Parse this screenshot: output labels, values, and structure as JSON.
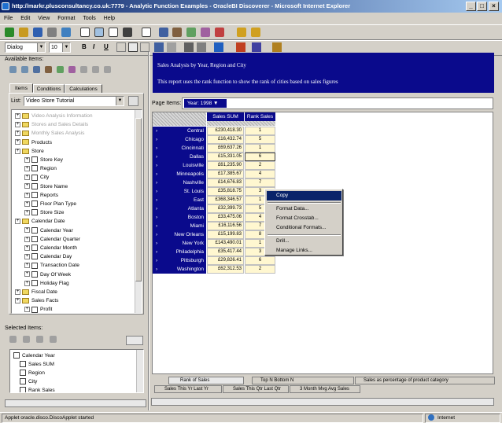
{
  "window": {
    "title": "http://markr.plusconsultancy.co.uk:7779 - Analytic Function Examples - OracleBI Discoverer - Microsoft Internet Explorer"
  },
  "menu": [
    "File",
    "Edit",
    "View",
    "Format",
    "Tools",
    "Help"
  ],
  "format_bar": {
    "font": "Dialog",
    "size": "10",
    "bold": "B",
    "italic": "I",
    "underline": "U"
  },
  "left": {
    "available_label": "Available Items:",
    "tabs": [
      "Items",
      "Conditions",
      "Calculations"
    ],
    "list_label": "List:",
    "list_value": "Video Store Tutorial",
    "tree": [
      {
        "label": "Video Analysis Information",
        "disabled": true,
        "kind": "folder",
        "level": 0
      },
      {
        "label": "Stores and Sales Details",
        "disabled": true,
        "kind": "folder",
        "level": 0
      },
      {
        "label": "Monthly Sales Analysis",
        "disabled": true,
        "kind": "folder",
        "level": 0
      },
      {
        "label": "Products",
        "kind": "folder",
        "level": 0
      },
      {
        "label": "Store",
        "kind": "folder",
        "level": 0
      },
      {
        "label": "Store Key",
        "kind": "item",
        "level": 1
      },
      {
        "label": "Region",
        "kind": "item",
        "level": 1
      },
      {
        "label": "City",
        "kind": "item",
        "level": 1
      },
      {
        "label": "Store Name",
        "kind": "item",
        "level": 1
      },
      {
        "label": "Reports",
        "kind": "item",
        "level": 1
      },
      {
        "label": "Floor Plan Type",
        "kind": "item",
        "level": 1
      },
      {
        "label": "Store Size",
        "kind": "item",
        "level": 1
      },
      {
        "label": "Calendar Date",
        "kind": "folder",
        "level": 0
      },
      {
        "label": "Calendar Year",
        "kind": "item",
        "level": 1
      },
      {
        "label": "Calendar Quarter",
        "kind": "item",
        "level": 1
      },
      {
        "label": "Calendar Month",
        "kind": "item",
        "level": 1
      },
      {
        "label": "Calendar Day",
        "kind": "item",
        "level": 1
      },
      {
        "label": "Transaction Date",
        "kind": "item",
        "level": 1
      },
      {
        "label": "Day Of Week",
        "kind": "item",
        "level": 1
      },
      {
        "label": "Holiday Flag",
        "kind": "item",
        "level": 1
      },
      {
        "label": "Fiscal Date",
        "kind": "folder",
        "level": 0
      },
      {
        "label": "Sales Facts",
        "kind": "folder",
        "level": 0
      },
      {
        "label": "Profit",
        "kind": "item",
        "level": 1
      }
    ],
    "selected_label": "Selected Items:",
    "selected": [
      "Calendar Year",
      "Sales SUM",
      "Region",
      "City",
      "Rank Sales"
    ]
  },
  "report": {
    "title": "Sales Analysis by Year, Region and City",
    "description": "This report uses the rank function to show the rank of cities based on sales figures",
    "page_items_label": "Page Items:",
    "page_item_value": "Year: 1998",
    "col_sum": "Sales SUM",
    "col_rank": "Rank Sales",
    "rows": [
      {
        "city": "Central",
        "sum": "£230,418.30",
        "rank": "1"
      },
      {
        "city": "Chicago",
        "sum": "£16,432.74",
        "rank": "5"
      },
      {
        "city": "Cincinnati",
        "sum": "£69,637.26",
        "rank": "1"
      },
      {
        "city": "Dallas",
        "sum": "£15,331.05",
        "rank": "6"
      },
      {
        "city": "Louisville",
        "sum": "£61,235.90",
        "rank": "2"
      },
      {
        "city": "Minneapolis",
        "sum": "£17,385.67",
        "rank": "4"
      },
      {
        "city": "Nashville",
        "sum": "£14,676.83",
        "rank": "7"
      },
      {
        "city": "St. Louis",
        "sum": "£35,818.75",
        "rank": "3"
      },
      {
        "city": "East",
        "sum": "£368,346.57",
        "rank": "1"
      },
      {
        "city": "Atlanta",
        "sum": "£32,399.73",
        "rank": "5"
      },
      {
        "city": "Boston",
        "sum": "£33,475.06",
        "rank": "4"
      },
      {
        "city": "Miami",
        "sum": "£16,116.56",
        "rank": "7"
      },
      {
        "city": "New Orleans",
        "sum": "£15,199.83",
        "rank": "8"
      },
      {
        "city": "New York",
        "sum": "£143,490.01",
        "rank": "1"
      },
      {
        "city": "Philadelphia",
        "sum": "£35,417.44",
        "rank": "3"
      },
      {
        "city": "Pittsburgh",
        "sum": "£29,826.41",
        "rank": "6"
      },
      {
        "city": "Washington",
        "sum": "£62,312.53",
        "rank": "2"
      }
    ]
  },
  "context_menu": [
    "Copy",
    "Format Data...",
    "Format Crosstab...",
    "Conditional Formats...",
    "Drill...",
    "Manage Links..."
  ],
  "sheet_tabs_row1": [
    "Rank of Sales",
    "Top N Bottom N",
    "Sales as percentage of product category"
  ],
  "sheet_tabs_row2": [
    "Sales This Yr Last Yr",
    "Sales This Qtr Last Qtr",
    "3 Month Mvg Avg Sales"
  ],
  "status": {
    "text": "Applet oracle.disco.DiscoApplet started",
    "zone": "Internet"
  }
}
